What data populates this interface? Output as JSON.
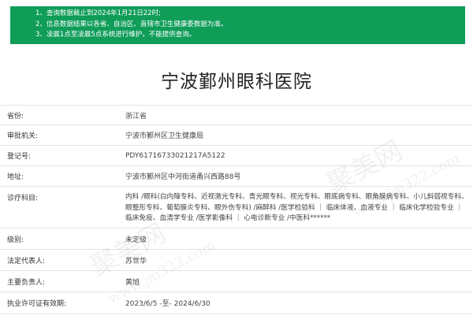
{
  "notice": {
    "lines": [
      "1、查询数据截止到2024年1月21日22时;",
      "2、信息数据结果以各省、自治区、直辖市卫生健康委数据为准。",
      "3、凌晨1点至凌晨5点系统进行维护，不能提供查询。"
    ]
  },
  "title": "宁波鄞州眼科医院",
  "rows": [
    {
      "label": "省份:",
      "value": "浙江省"
    },
    {
      "label": "审批机关:",
      "value": "宁波市鄞州区卫生健康局"
    },
    {
      "label": "登记号:",
      "value": "PDY61716733021217A5122"
    },
    {
      "label": "地址:",
      "value": "宁波市鄞州区中河街道甬兴西路88号"
    },
    {
      "label": "诊疗科目:",
      "value": "内科 /眼科(白内障专科、近视激光专科、青光眼专科、视光专科、眼底病专科、眼角膜病专科、小儿斜弱视专科、眼整形专科、葡萄膜炎专科、眼外伤专科) /麻醉科 /医学检验科 ｜ 临床体液、血液专业 ｜ 临床化学检验专业 ｜ 临床免疫、血清学专业 /医学影像科 ｜ 心电诊断专业 /中医科******"
    },
    {
      "label": "级别:",
      "value": "未定级"
    },
    {
      "label": "法定代表人:",
      "value": "苏世华"
    },
    {
      "label": "主要负责人:",
      "value": "黄旭"
    },
    {
      "label": "执业许可证有效期:",
      "value": "2023/6/5 -至- 2024/6/30"
    }
  ],
  "watermark": {
    "brand": "聚美网",
    "domain": "www.jm322.com"
  }
}
